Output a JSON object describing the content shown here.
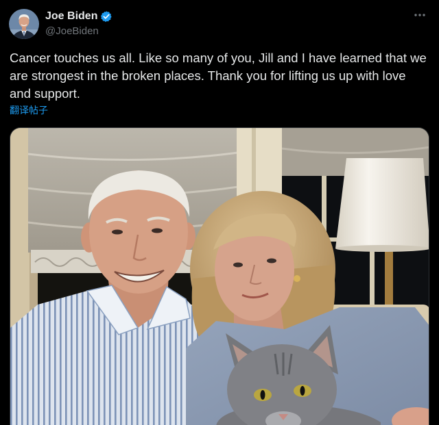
{
  "colors": {
    "background": "#000000",
    "text": "#e7e9ea",
    "secondary_text": "#71767b",
    "accent": "#1d9bf0",
    "border": "#2f3336"
  },
  "post": {
    "author": {
      "name": "Joe Biden",
      "handle": "@JoeBiden",
      "verified": true,
      "avatar_icon": "avatar",
      "verified_icon": "verified-badge-icon"
    },
    "more_icon": "more-icon",
    "text_lines": [
      "Cancer touches us all. Like so many of you, Jill and I have learned that we",
      "are strongest in the broken places. Thank you for lifting us up with love",
      "and support."
    ],
    "translate_label": "翻译帖子"
  }
}
